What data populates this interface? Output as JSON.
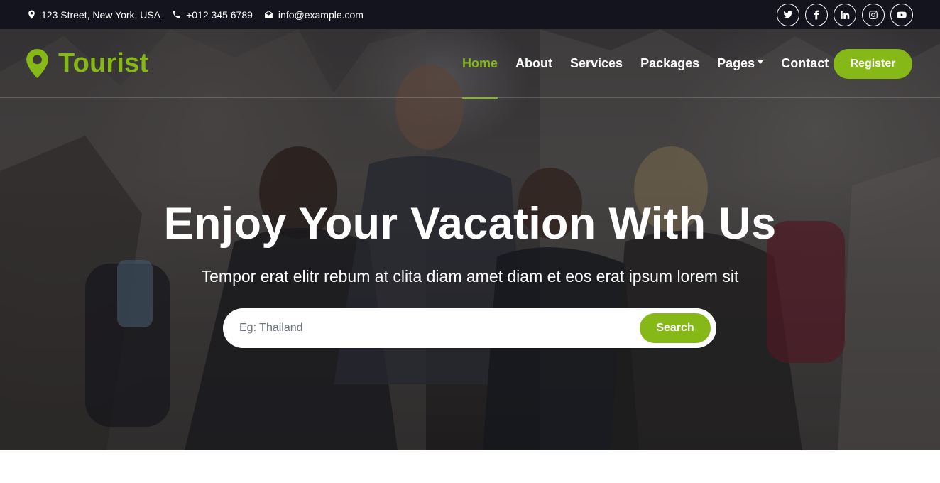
{
  "topbar": {
    "address": "123 Street, New York, USA",
    "phone": "+012 345 6789",
    "email": "info@example.com",
    "contact_icons": [
      "map-marker-icon",
      "phone-icon",
      "envelope-icon"
    ],
    "social_icons": [
      "twitter-icon",
      "facebook-icon",
      "linkedin-icon",
      "instagram-icon",
      "youtube-icon"
    ]
  },
  "brand": {
    "name": "Tourist",
    "icon": "map-marker-icon"
  },
  "nav": {
    "items": [
      {
        "label": "Home",
        "active": true
      },
      {
        "label": "About"
      },
      {
        "label": "Services"
      },
      {
        "label": "Packages"
      },
      {
        "label": "Pages",
        "dropdown": true
      },
      {
        "label": "Contact"
      }
    ],
    "register_label": "Register"
  },
  "hero": {
    "title": "Enjoy Your Vacation With Us",
    "subtitle": "Tempor erat elitr rebum at clita diam amet diam et eos erat ipsum lorem sit",
    "search_placeholder": "Eg: Thailand",
    "search_value": "",
    "search_button": "Search"
  },
  "colors": {
    "accent": "#86b817",
    "topbar_bg": "#14141f",
    "text_light": "#ffffff"
  }
}
